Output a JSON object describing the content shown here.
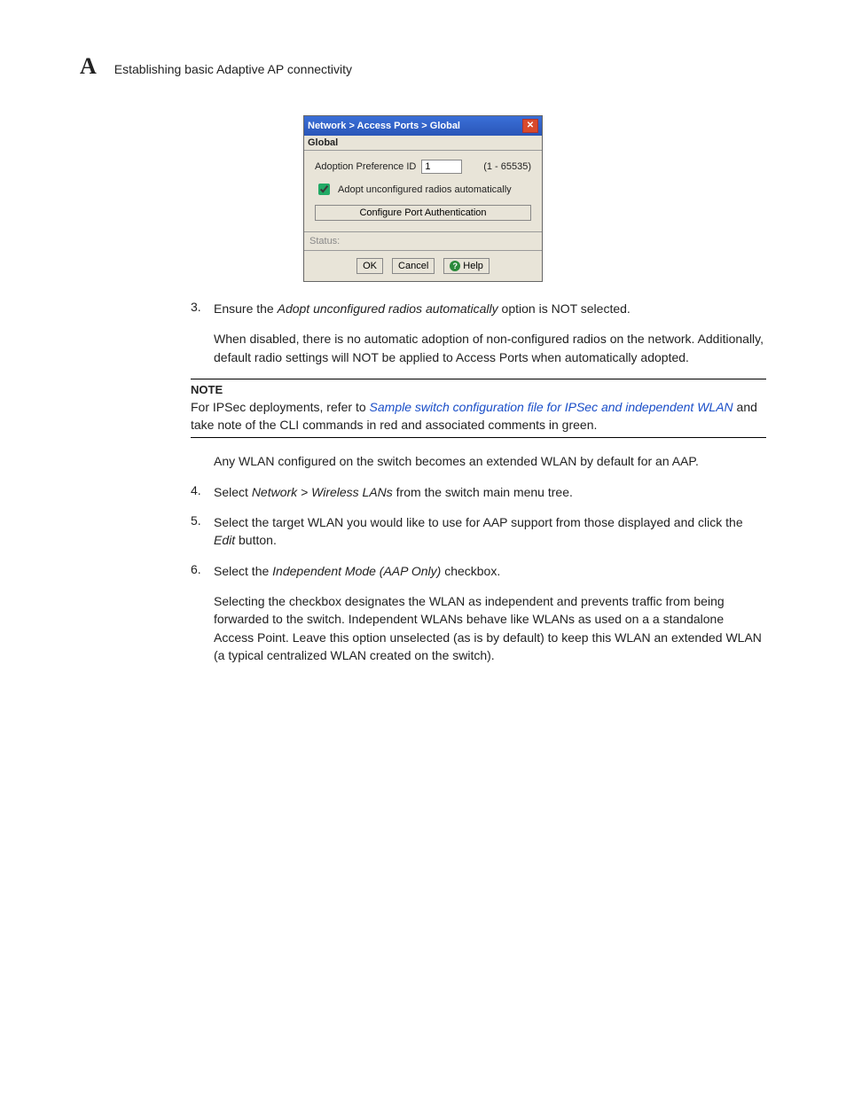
{
  "header": {
    "letter": "A",
    "title": "Establishing basic Adaptive AP connectivity"
  },
  "dialog": {
    "breadcrumb": "Network > Access Ports > Global",
    "tab": "Global",
    "adopt_label": "Adoption Preference ID",
    "adopt_value": "1",
    "adopt_range": "(1 - 65535)",
    "checkbox_label": "Adopt unconfigured radios automatically",
    "port_auth_btn": "Configure Port Authentication",
    "status_label": "Status:",
    "ok": "OK",
    "cancel": "Cancel",
    "help": "Help"
  },
  "steps": {
    "3": {
      "num": "3.",
      "p1a": "Ensure the ",
      "p1em": "Adopt unconfigured radios automatically",
      "p1b": " option is NOT selected.",
      "p2": "When disabled, there is no automatic adoption of non-configured radios on the network. Additionally, default radio settings will NOT be applied to Access Ports when automatically adopted."
    },
    "4": {
      "num": "4.",
      "a": "Select ",
      "em": "Network > Wireless LANs",
      "b": " from the switch main menu tree."
    },
    "5": {
      "num": "5.",
      "a": "Select the target WLAN you would like to use for AAP support from those displayed and click the ",
      "em": "Edit",
      "b": " button."
    },
    "6": {
      "num": "6.",
      "p1a": "Select the ",
      "p1em": "Independent Mode (AAP Only)",
      "p1b": " checkbox.",
      "p2": "Selecting the checkbox designates the WLAN as independent and prevents traffic from being forwarded to the switch. Independent WLANs behave like WLANs as used on a a standalone Access Point. Leave this option unselected (as is by default) to keep this WLAN an extended WLAN (a typical centralized WLAN created on the switch)."
    }
  },
  "note": {
    "label": "NOTE",
    "pre": "For IPSec deployments, refer to ",
    "link": "Sample switch configuration file for IPSec and independent WLAN",
    "post": " and take note of the CLI commands in red and associated comments in green."
  },
  "between_note_and_step4": "Any WLAN configured on the switch becomes an extended WLAN by default for an AAP."
}
